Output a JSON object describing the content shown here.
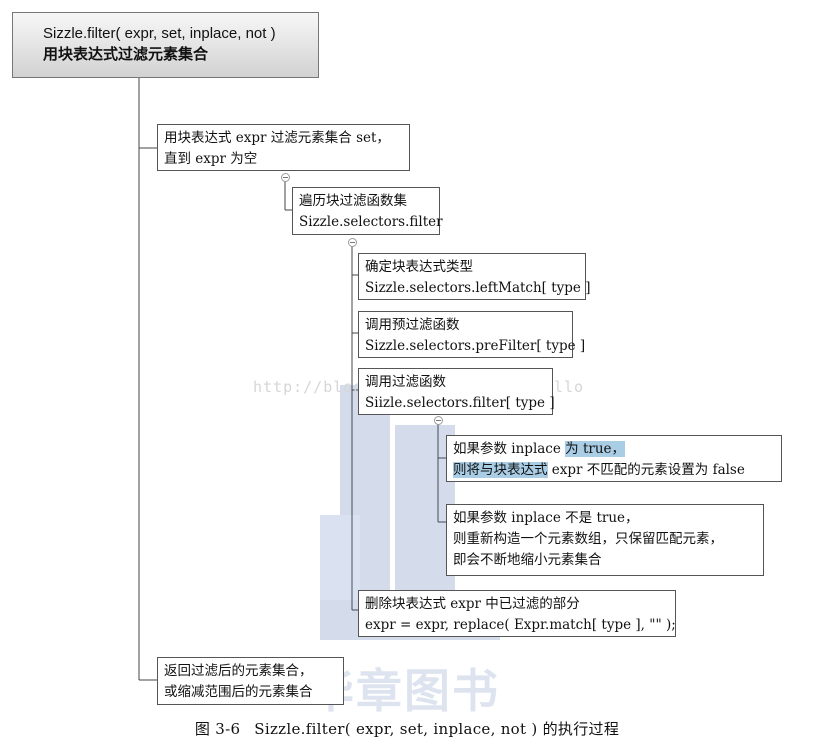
{
  "watermark": {
    "url": "http://blog.csdn.net/yangzhihello",
    "logo_text": "华章图书"
  },
  "root": {
    "line1": "Sizzle.filter( expr, set, inplace, not )",
    "line2": "用块表达式过滤元素集合"
  },
  "nodes": {
    "loop": {
      "line1": "用块表达式 expr 过滤元素集合 set，",
      "line2": "直到 expr 为空"
    },
    "iterate": {
      "line1": "遍历块过滤函数集",
      "line2": "Sizzle.selectors.filter"
    },
    "determine_type": {
      "line1": "确定块表达式类型",
      "line2": "Sizzle.selectors.leftMatch[ type ]"
    },
    "call_prefilter": {
      "line1": "调用预过滤函数",
      "line2": "Sizzle.selectors.preFilter[ type ]"
    },
    "call_filter": {
      "line1": "调用过滤函数",
      "line2": "Siizle.selectors.filter[ type ]"
    },
    "inplace_true": {
      "line1_a": "如果参数 inplace ",
      "line1_b": "为 true，",
      "line2_a": "则将与块表达式",
      "line2_b": " expr 不匹配的元素设置为 false"
    },
    "inplace_false": {
      "line1": "如果参数 inplace 不是 true，",
      "line2": "则重新构造一个元素数组，只保留匹配元素，",
      "line3": "即会不断地缩小元素集合"
    },
    "remove_filtered": {
      "line1": "删除块表达式 expr 中已过滤的部分",
      "line2": "expr = expr, replace( Expr.match[ type ], \"\"  );"
    },
    "return_set": {
      "line1": "返回过滤后的元素集合，",
      "line2": "或缩减范围后的元素集合"
    }
  },
  "caption": {
    "figure_no": "图 3-6",
    "text": "Sizzle.filter( expr, set, inplace, not ) 的执行过程"
  }
}
